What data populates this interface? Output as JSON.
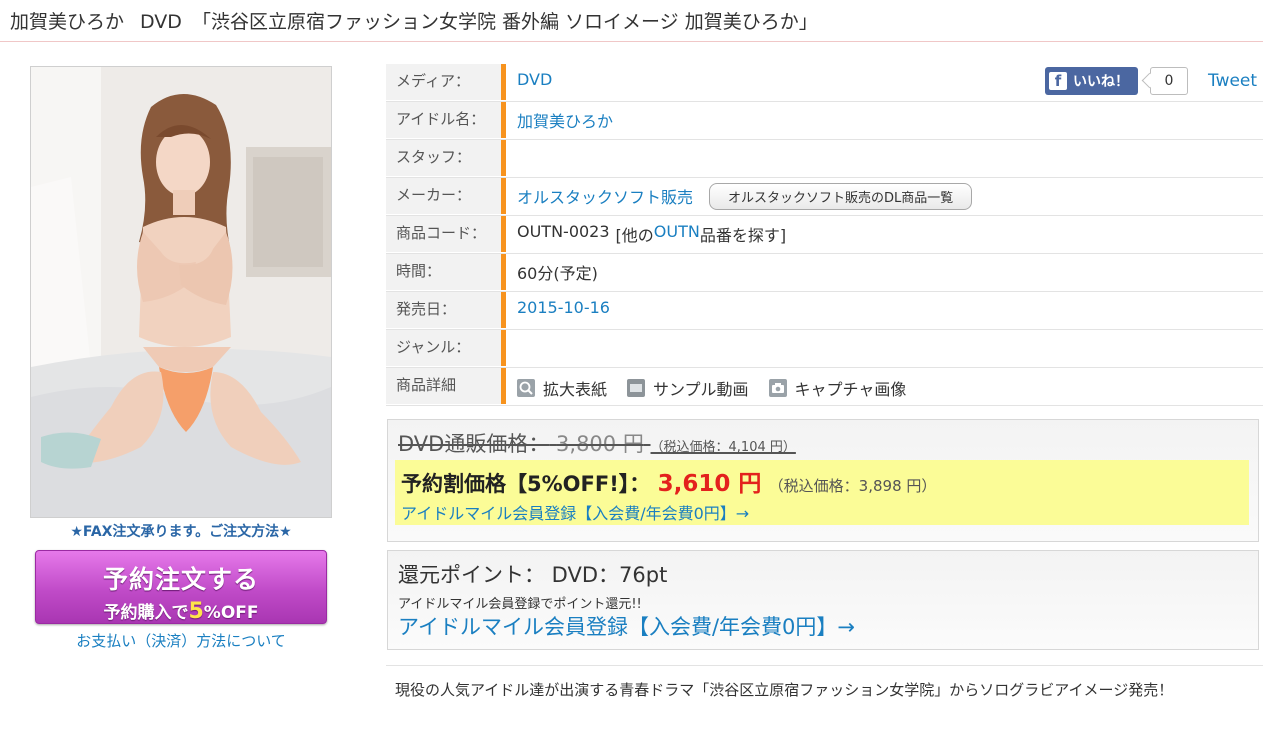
{
  "title": {
    "name": "加賀美ひろか",
    "media": "DVD",
    "product": "「渋谷区立原宿ファッション女学院 番外編 ソロイメージ 加賀美ひろか」"
  },
  "left": {
    "fax_note": "★FAX注文承ります。ご注文方法★",
    "order_button": {
      "line1": "予約注文する",
      "line2_pre": "予約購入で",
      "line2_num": "5",
      "line2_post": "%OFF"
    },
    "payment_link": "お支払い（決済）方法について"
  },
  "social": {
    "like_label": "いいね！",
    "like_count": "0",
    "tweet_label": "Tweet"
  },
  "specs": {
    "media": {
      "label": "メディア：",
      "value": "DVD"
    },
    "idol": {
      "label": "アイドル名：",
      "value": "加賀美ひろか"
    },
    "staff": {
      "label": "スタッフ：",
      "value": ""
    },
    "maker": {
      "label": "メーカー：",
      "value": "オルスタックソフト販売",
      "button": "オルスタックソフト販売のDL商品一覧"
    },
    "code": {
      "label": "商品コード：",
      "value": "OUTN-0023",
      "pre": "[他の",
      "link": "OUTN",
      "post": "品番を探す]"
    },
    "time": {
      "label": "時間：",
      "value": "60分(予定)"
    },
    "release": {
      "label": "発売日：",
      "value": "2015-10-16"
    },
    "genre": {
      "label": "ジャンル：",
      "value": ""
    },
    "detail": {
      "label": "商品詳細",
      "zoom": "拡大表紙",
      "sample": "サンプル動画",
      "capture": "キャプチャ画像"
    }
  },
  "price": {
    "regular_label": "DVD通販価格：",
    "regular_amount": "3,800 円",
    "regular_tax": "（税込価格：4,104 円）",
    "sale_label": "予約割価格【5%OFF!】：",
    "sale_amount": "3,610 円",
    "sale_tax": "（税込価格：3,898 円）",
    "member_link": "アイドルマイル会員登録【入会費/年会費0円】→"
  },
  "points": {
    "title": "還元ポイント： DVD：76pt",
    "sub": "アイドルマイル会員登録でポイント還元!!",
    "member_link": "アイドルマイル会員登録【入会費/年会費0円】→"
  },
  "description": "現役の人気アイドル達が出演する青春ドラマ「渋谷区立原宿ファッション女学院」からソログラビアイメージ発売！",
  "colors": {
    "accent": "#f7931e",
    "link": "#1a7fc1",
    "sale_price": "#e3211d",
    "highlight": "#fbfc97",
    "order_button": "#c04bc8"
  }
}
